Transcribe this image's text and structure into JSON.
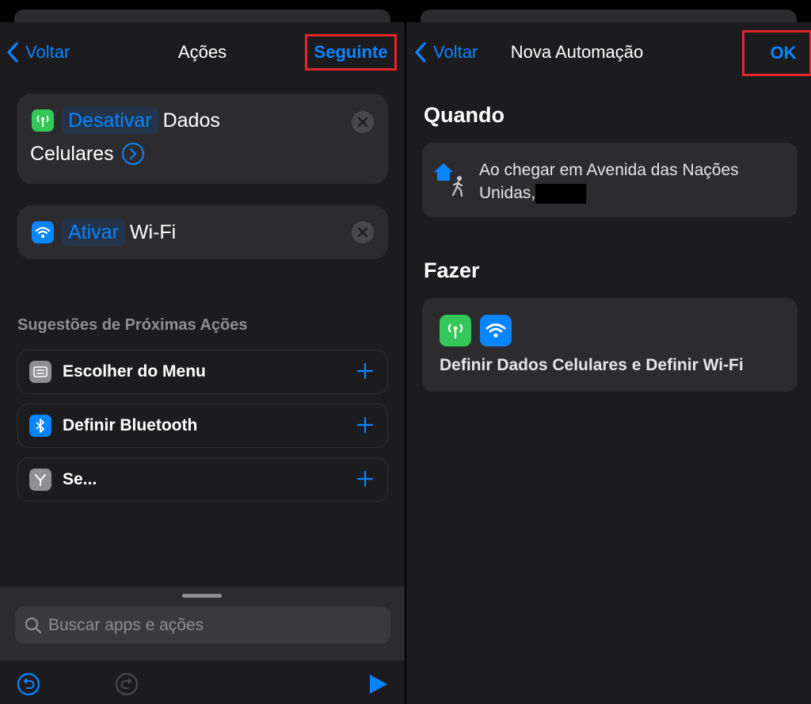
{
  "left": {
    "nav": {
      "back_label": "Voltar",
      "title": "Ações",
      "next_label": "Seguinte"
    },
    "actions": [
      {
        "icon": "cellular-antenna-icon",
        "color": "#34c759",
        "token": "Desativar",
        "text_line1": "Dados",
        "text_line2": "Celulares"
      },
      {
        "icon": "wifi-icon",
        "color": "#0a84ff",
        "token": "Ativar",
        "text": "Wi-Fi"
      }
    ],
    "suggestions_title": "Sugestões de Próximas Ações",
    "suggestions": [
      {
        "icon": "menu-icon",
        "label": "Escolher do Menu"
      },
      {
        "icon": "bluetooth-icon",
        "label": "Definir Bluetooth"
      },
      {
        "icon": "branch-icon",
        "label": "Se..."
      }
    ],
    "search": {
      "placeholder": "Buscar apps e ações"
    }
  },
  "right": {
    "nav": {
      "back_label": "Voltar",
      "title": "Nova Automação",
      "ok_label": "OK"
    },
    "when_title": "Quando",
    "trigger": {
      "icon": "home-arrive-icon",
      "text": "Ao chegar em Avenida das Nações Unidas,"
    },
    "do_title": "Fazer",
    "do": {
      "icons": [
        "cellular-antenna-icon",
        "wifi-icon"
      ],
      "text": "Definir Dados Celulares e Definir Wi-Fi"
    }
  },
  "colors": {
    "accent": "#0a84ff",
    "highlight_box": "#e0262a",
    "green": "#34c759",
    "background": "#1c1c1e",
    "card": "#2c2c2e"
  }
}
